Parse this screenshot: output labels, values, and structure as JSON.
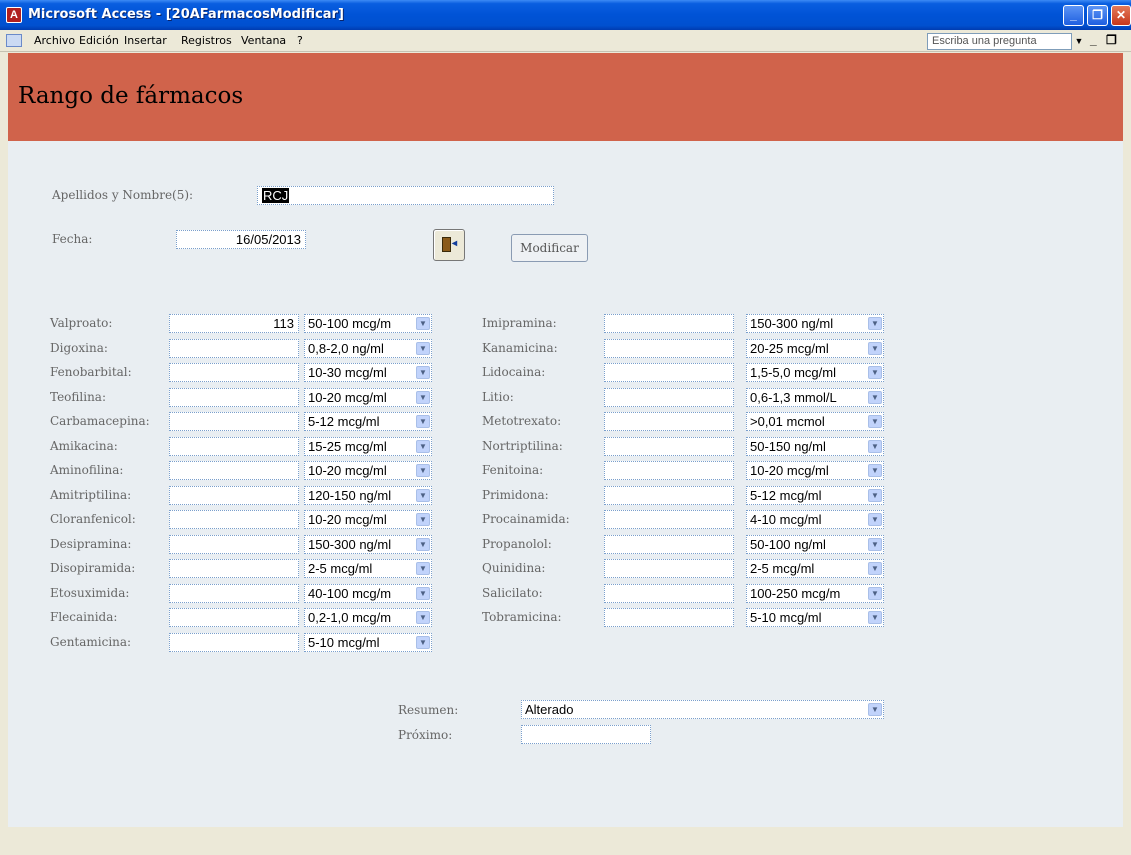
{
  "window": {
    "title": "Microsoft Access - [20AFarmacosModificar]"
  },
  "menu": {
    "items": [
      "Archivo",
      "Edición",
      "Insertar",
      "Registros",
      "Ventana",
      "?"
    ],
    "ask_placeholder": "Escriba una pregunta"
  },
  "form": {
    "header_title": "Rango de fármacos",
    "apellidos_label": "Apellidos y Nombre(5):",
    "apellidos_value": "RCJ",
    "fecha_label": "Fecha:",
    "fecha_value": "16/05/2013",
    "modificar_label": "Modificar",
    "resumen_label": "Resumen:",
    "resumen_value": "Alterado",
    "proximo_label": "Próximo:",
    "proximo_value": ""
  },
  "left_drugs": [
    {
      "label": "Valproato:",
      "value": "113",
      "range": "50-100 mcg/m"
    },
    {
      "label": "Digoxina:",
      "value": "",
      "range": "0,8-2,0 ng/ml"
    },
    {
      "label": "Fenobarbital:",
      "value": "",
      "range": "10-30 mcg/ml"
    },
    {
      "label": "Teofilina:",
      "value": "",
      "range": "10-20 mcg/ml"
    },
    {
      "label": "Carbamacepina:",
      "value": "",
      "range": "5-12 mcg/ml"
    },
    {
      "label": "Amikacina:",
      "value": "",
      "range": "15-25 mcg/ml"
    },
    {
      "label": "Aminofilina:",
      "value": "",
      "range": "10-20 mcg/ml"
    },
    {
      "label": "Amitriptilina:",
      "value": "",
      "range": "120-150 ng/ml"
    },
    {
      "label": "Cloranfenicol:",
      "value": "",
      "range": "10-20 mcg/ml"
    },
    {
      "label": "Desipramina:",
      "value": "",
      "range": "150-300 ng/ml"
    },
    {
      "label": "Disopiramida:",
      "value": "",
      "range": "2-5 mcg/ml"
    },
    {
      "label": "Etosuximida:",
      "value": "",
      "range": "40-100 mcg/m"
    },
    {
      "label": "Flecainida:",
      "value": "",
      "range": "0,2-1,0 mcg/m"
    },
    {
      "label": "Gentamicina:",
      "value": "",
      "range": "5-10 mcg/ml"
    }
  ],
  "right_drugs": [
    {
      "label": "Imipramina:",
      "value": "",
      "range": "150-300 ng/ml"
    },
    {
      "label": "Kanamicina:",
      "value": "",
      "range": "20-25 mcg/ml"
    },
    {
      "label": "Lidocaina:",
      "value": "",
      "range": "1,5-5,0 mcg/ml"
    },
    {
      "label": "Litio:",
      "value": "",
      "range": "0,6-1,3 mmol/L"
    },
    {
      "label": "Metotrexato:",
      "value": "",
      "range": ">0,01 mcmol"
    },
    {
      "label": "Nortriptilina:",
      "value": "",
      "range": "50-150 ng/ml"
    },
    {
      "label": "Fenitoina:",
      "value": "",
      "range": "10-20 mcg/ml"
    },
    {
      "label": "Primidona:",
      "value": "",
      "range": "5-12 mcg/ml"
    },
    {
      "label": "Procainamida:",
      "value": "",
      "range": "4-10 mcg/ml"
    },
    {
      "label": "Propanolol:",
      "value": "",
      "range": "50-100 ng/ml"
    },
    {
      "label": "Quinidina:",
      "value": "",
      "range": "2-5 mcg/ml"
    },
    {
      "label": "Salicilato:",
      "value": "",
      "range": "100-250 mcg/m"
    },
    {
      "label": "Tobramicina:",
      "value": "",
      "range": "5-10 mcg/ml"
    }
  ]
}
